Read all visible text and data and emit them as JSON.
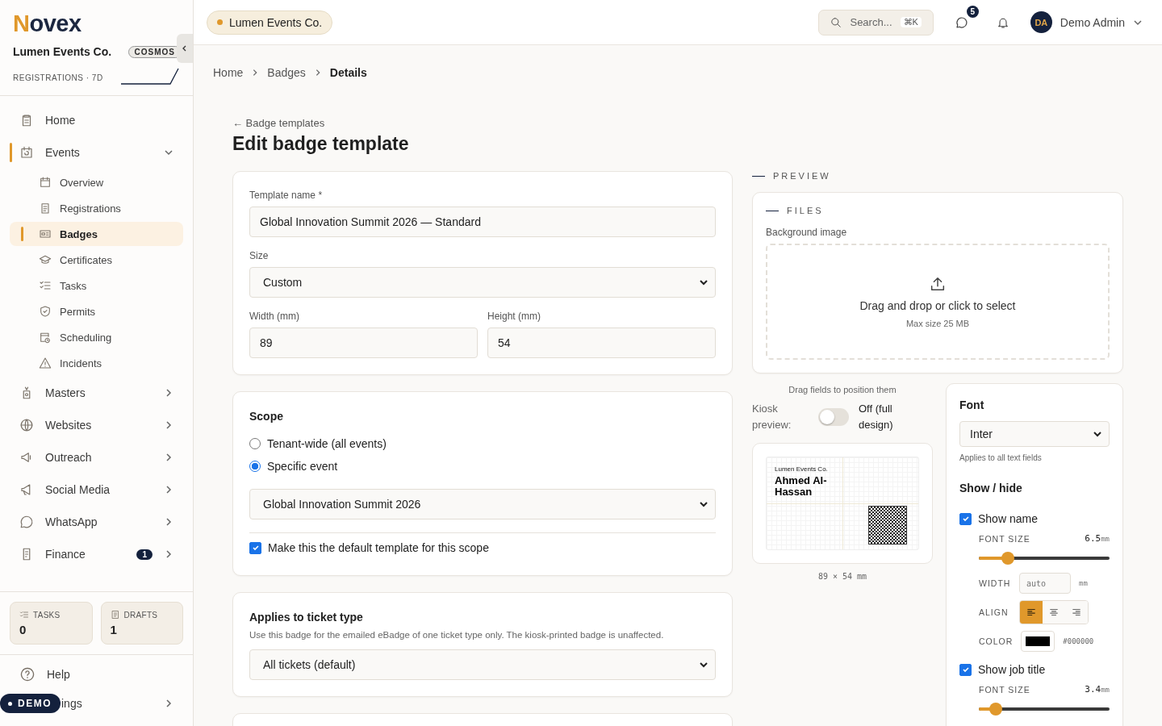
{
  "sidebar": {
    "logo": {
      "mark": "N",
      "rest": "ovex"
    },
    "org": "Lumen Events Co.",
    "plan": "COSMOS",
    "stat_label": "REGISTRATIONS · 7D",
    "nav": [
      {
        "label": "Home",
        "selected": false
      },
      {
        "label": "Events",
        "selected": false,
        "expanded": true,
        "children": [
          {
            "label": "Overview",
            "selected": false
          },
          {
            "label": "Registrations",
            "selected": false
          },
          {
            "label": "Badges",
            "selected": true
          },
          {
            "label": "Certificates",
            "selected": false
          },
          {
            "label": "Tasks",
            "selected": false
          },
          {
            "label": "Permits",
            "selected": false
          },
          {
            "label": "Scheduling",
            "selected": false
          },
          {
            "label": "Incidents",
            "selected": false
          }
        ]
      },
      {
        "label": "Masters",
        "selected": false,
        "expanded": false
      },
      {
        "label": "Websites",
        "selected": false,
        "expanded": false
      },
      {
        "label": "Outreach",
        "selected": false,
        "expanded": false
      },
      {
        "label": "Social Media",
        "selected": false,
        "expanded": false
      },
      {
        "label": "WhatsApp",
        "selected": false,
        "expanded": false
      },
      {
        "label": "Finance",
        "selected": false,
        "expanded": false,
        "badge": "1"
      }
    ],
    "counters": [
      {
        "label": "TASKS",
        "value": "0"
      },
      {
        "label": "DRAFTS",
        "value": "1"
      }
    ],
    "footer": [
      {
        "label": "Help"
      },
      {
        "label": "ings",
        "expanded": false
      }
    ],
    "demo_pill": "DEMO"
  },
  "topbar": {
    "tenant": "Lumen Events Co.",
    "search": {
      "placeholder": "Search...",
      "shortcut": "⌘K"
    },
    "messages_badge": "5",
    "user": {
      "initials": "DA",
      "name": "Demo Admin"
    }
  },
  "breadcrumbs": [
    {
      "label": "Home",
      "current": false
    },
    {
      "label": "Badges",
      "current": false
    },
    {
      "label": "Details",
      "current": true
    }
  ],
  "back_link": "← Badge templates",
  "title": "Edit badge template",
  "details": {
    "template_name": {
      "label": "Template name *",
      "value": "Global Innovation Summit 2026 — Standard"
    },
    "size": {
      "label": "Size",
      "value": "Custom"
    },
    "width": {
      "label": "Width (mm)",
      "value": "89"
    },
    "height": {
      "label": "Height (mm)",
      "value": "54"
    }
  },
  "scope": {
    "title": "Scope",
    "options": [
      {
        "label": "Tenant-wide (all events)",
        "selected": false
      },
      {
        "label": "Specific event",
        "selected": true
      }
    ],
    "event": "Global Innovation Summit 2026",
    "default": {
      "label": "Make this the default template for this scope",
      "checked": true
    }
  },
  "ticket_type": {
    "title": "Applies to ticket type",
    "description": "Use this badge for the emailed eBadge of one ticket type only. The kiosk-printed badge is unaffected.",
    "value": "All tickets (default)"
  },
  "preview": {
    "label": "PREVIEW",
    "files": {
      "label": "FILES",
      "field_label": "Background image",
      "drop_text": "Drag and drop or click to select",
      "drop_hint": "Max size 25 MB"
    },
    "drag_hint": "Drag fields to position them",
    "kiosk": {
      "label": "Kiosk preview:",
      "on": false,
      "state_text": "Off (full design)"
    },
    "badge": {
      "org": "Lumen Events Co.",
      "name": "Ahmed Al-Hassan"
    },
    "dimensions": "89 × 54 mm"
  },
  "font": {
    "title": "Font",
    "value": "Inter",
    "hint": "Applies to all text fields",
    "show_hide": "Show / hide",
    "fields": [
      {
        "label": "Show name",
        "checked": true,
        "font_size_label": "FONT SIZE",
        "font_size": "6.5",
        "unit": "mm",
        "level": 0.19,
        "width_label": "WIDTH",
        "width_placeholder": "auto",
        "width_unit": "mm",
        "align_label": "ALIGN",
        "align": [
          {
            "selected": true
          },
          {
            "selected": false
          },
          {
            "selected": false
          }
        ],
        "color_label": "COLOR",
        "color": "#000000",
        "color_text": "#000000"
      },
      {
        "label": "Show job title",
        "checked": true,
        "font_size_label": "FONT SIZE",
        "font_size": "3.4",
        "unit": "mm",
        "level": 0.09
      }
    ]
  }
}
